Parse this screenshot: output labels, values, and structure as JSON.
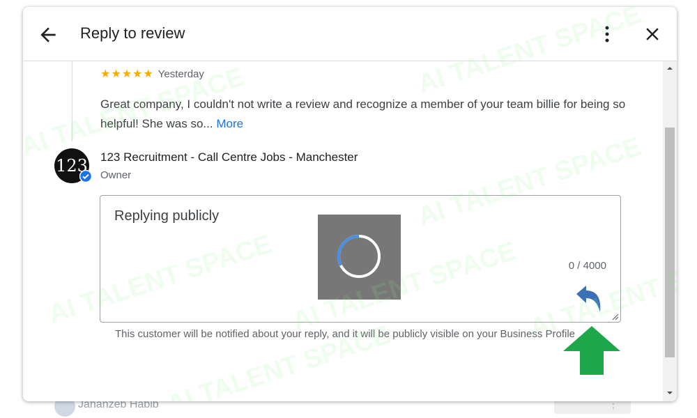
{
  "background_item": {
    "name": "Jahanzeb Habib"
  },
  "dialog": {
    "title": "Reply to review"
  },
  "review": {
    "rating": 5,
    "stars": "★★★★★",
    "date": "Yesterday",
    "text": "Great company, I couldn't not write a review and recognize a member of your team billie for being so helpful! She was so... ",
    "more_label": "More"
  },
  "owner": {
    "avatar_text": "123",
    "name": "123 Recruitment - Call Centre Jobs - Manchester",
    "role": "Owner"
  },
  "reply": {
    "placeholder": "Replying publicly",
    "char_count": "0 / 4000",
    "notice": "This customer will be notified about your reply, and it will be publicly visible on your Business Profile"
  },
  "watermark": {
    "text": "AI TALENT SPACE"
  },
  "colors": {
    "accent": "#1a73e8",
    "star": "#f9ab00",
    "reply_arrow": "#3b6fb6",
    "green_arrow": "#1ea64a",
    "spinner_bg": "#777777"
  },
  "icons": {
    "back": "arrow-back",
    "more": "more-vert",
    "close": "close-x",
    "verified": "verified-check",
    "reply": "reply-arrow",
    "annotation": "green-up-arrow"
  }
}
